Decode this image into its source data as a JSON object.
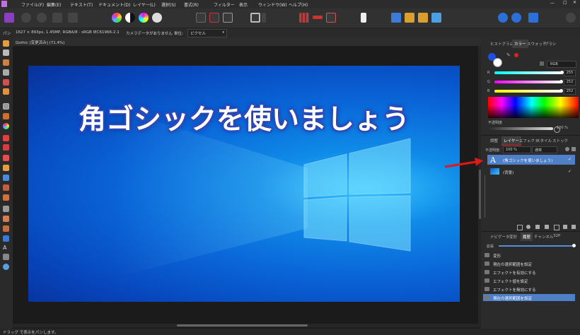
{
  "menu": [
    "ファイル(F)",
    "編集(E)",
    "テキスト(T)",
    "ドキュメント(D)",
    "レイヤー(L)",
    "選択(S)",
    "書式(R)",
    "フィルター",
    "表示",
    "ウィンドウ(W)",
    "ヘルプ(H)"
  ],
  "context": {
    "tool": "パン",
    "doc_info": "1627 × 893px, 1.45MP, RGBA/8 - sRGB IEC61966-2.1",
    "camera": "カメラデータがありません",
    "units_label": "単位:",
    "units_value": "ピクセル"
  },
  "document": {
    "tab_title": "Gothic [変更済み] (71.4%)",
    "headline": "角ゴシックを使いましょう"
  },
  "color_panel": {
    "tabs": [
      "ヒストグラム",
      "カラー",
      "スウォッチ",
      "ブラシ"
    ],
    "mode": "RGB",
    "channels": [
      {
        "label": "R",
        "value": "255",
        "fraction": 1.0,
        "color": "#d23cd8"
      },
      {
        "label": "G",
        "value": "252",
        "fraction": 0.99,
        "color": "#c03070"
      },
      {
        "label": "B",
        "value": "252",
        "fraction": 0.99,
        "color": "#c8c000"
      }
    ],
    "opacity_label": "不透明度",
    "opacity_value": "100 %"
  },
  "layers_panel": {
    "tabs": [
      "調整",
      "レイヤー",
      "エフェクト",
      "スタイル",
      "ストック"
    ],
    "opacity_label": "不透明度:",
    "opacity_value": "100 %",
    "blend_mode": "通常",
    "layers": [
      {
        "name": "(角ゴシックを使いましょう)",
        "type_icon": "A",
        "selected": true
      },
      {
        "name": "(背景)",
        "type_icon": "image",
        "selected": false
      }
    ]
  },
  "history_panel": {
    "tabs": [
      "ナビゲータ",
      "変形",
      "履歴",
      "チャンネル",
      "32P"
    ],
    "slider_label": "拡張",
    "items": [
      {
        "label": "変形",
        "selected": false
      },
      {
        "label": "現在の選択範囲を設定",
        "selected": false
      },
      {
        "label": "エフェクトを有効にする",
        "selected": false
      },
      {
        "label": "エフェクト値を設定",
        "selected": false
      },
      {
        "label": "エフェクトを無効にする",
        "selected": false
      },
      {
        "label": "現在の選択範囲を設定",
        "selected": true
      }
    ]
  },
  "status": "ドラッグ で表示をパンします。"
}
